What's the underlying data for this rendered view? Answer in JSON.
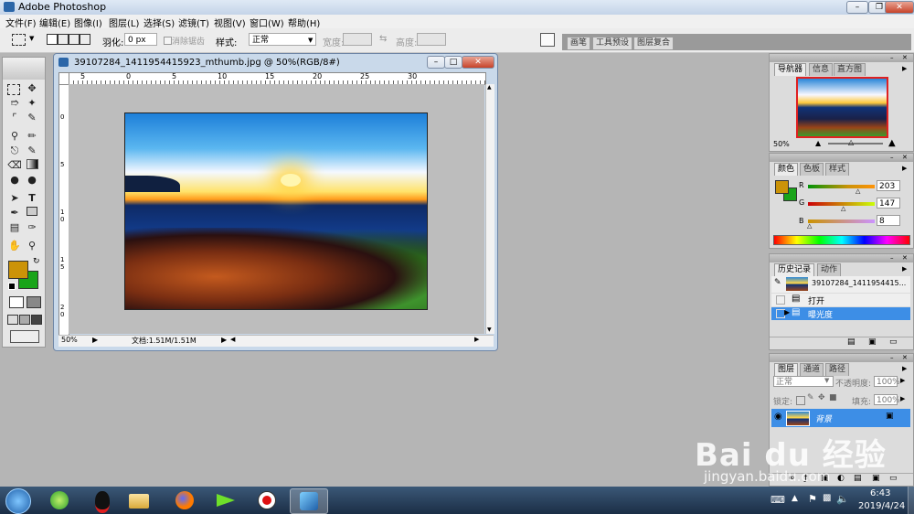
{
  "window": {
    "title": "Adobe Photoshop"
  },
  "menu": [
    "文件(F)",
    "编辑(E)",
    "图像(I)",
    "图层(L)",
    "选择(S)",
    "滤镜(T)",
    "视图(V)",
    "窗口(W)",
    "帮助(H)"
  ],
  "options": {
    "feather_label": "羽化:",
    "feather_value": "0 px",
    "antialias_label": "消除锯齿",
    "style_label": "样式:",
    "style_value": "正常",
    "width_label": "宽度:",
    "height_label": "高度:",
    "palette_tabs": [
      "画笔",
      "工具预设",
      "图层复合"
    ]
  },
  "document": {
    "title": "39107284_1411954415923_mthumb.jpg @ 50%(RGB/8#)",
    "ruler_top": [
      "5",
      "0",
      "5",
      "10",
      "15",
      "20",
      "25",
      "30"
    ],
    "ruler_left": [
      "0",
      "5",
      "1 0",
      "1 5",
      "2 0"
    ],
    "zoom": "50%",
    "doc_info": "文档:1.51M/1.51M"
  },
  "navigator": {
    "tabs": [
      "导航器",
      "信息",
      "直方图"
    ],
    "zoom": "50%"
  },
  "color": {
    "tabs": [
      "颜色",
      "色板",
      "样式"
    ],
    "r_label": "R",
    "g_label": "G",
    "b_label": "B",
    "r": "203",
    "g": "147",
    "b": "8",
    "foreground": "#cb9308",
    "background": "#19a419"
  },
  "history": {
    "tabs": [
      "历史记录",
      "动作"
    ],
    "snapshot": "39107284_1411954415...",
    "items": [
      "打开",
      "曝光度"
    ]
  },
  "layers": {
    "tabs": [
      "图层",
      "通道",
      "路径"
    ],
    "blend_mode": "正常",
    "opacity_label": "不透明度:",
    "opacity": "100%",
    "lock_label": "锁定:",
    "fill_label": "填充:",
    "fill": "100%",
    "layer_name": "背景"
  },
  "watermark": {
    "brand": "Bai du 经验",
    "url": "jingyan.baidu.com"
  },
  "taskbar": {
    "time": "6:43",
    "date": "2019/4/24"
  }
}
